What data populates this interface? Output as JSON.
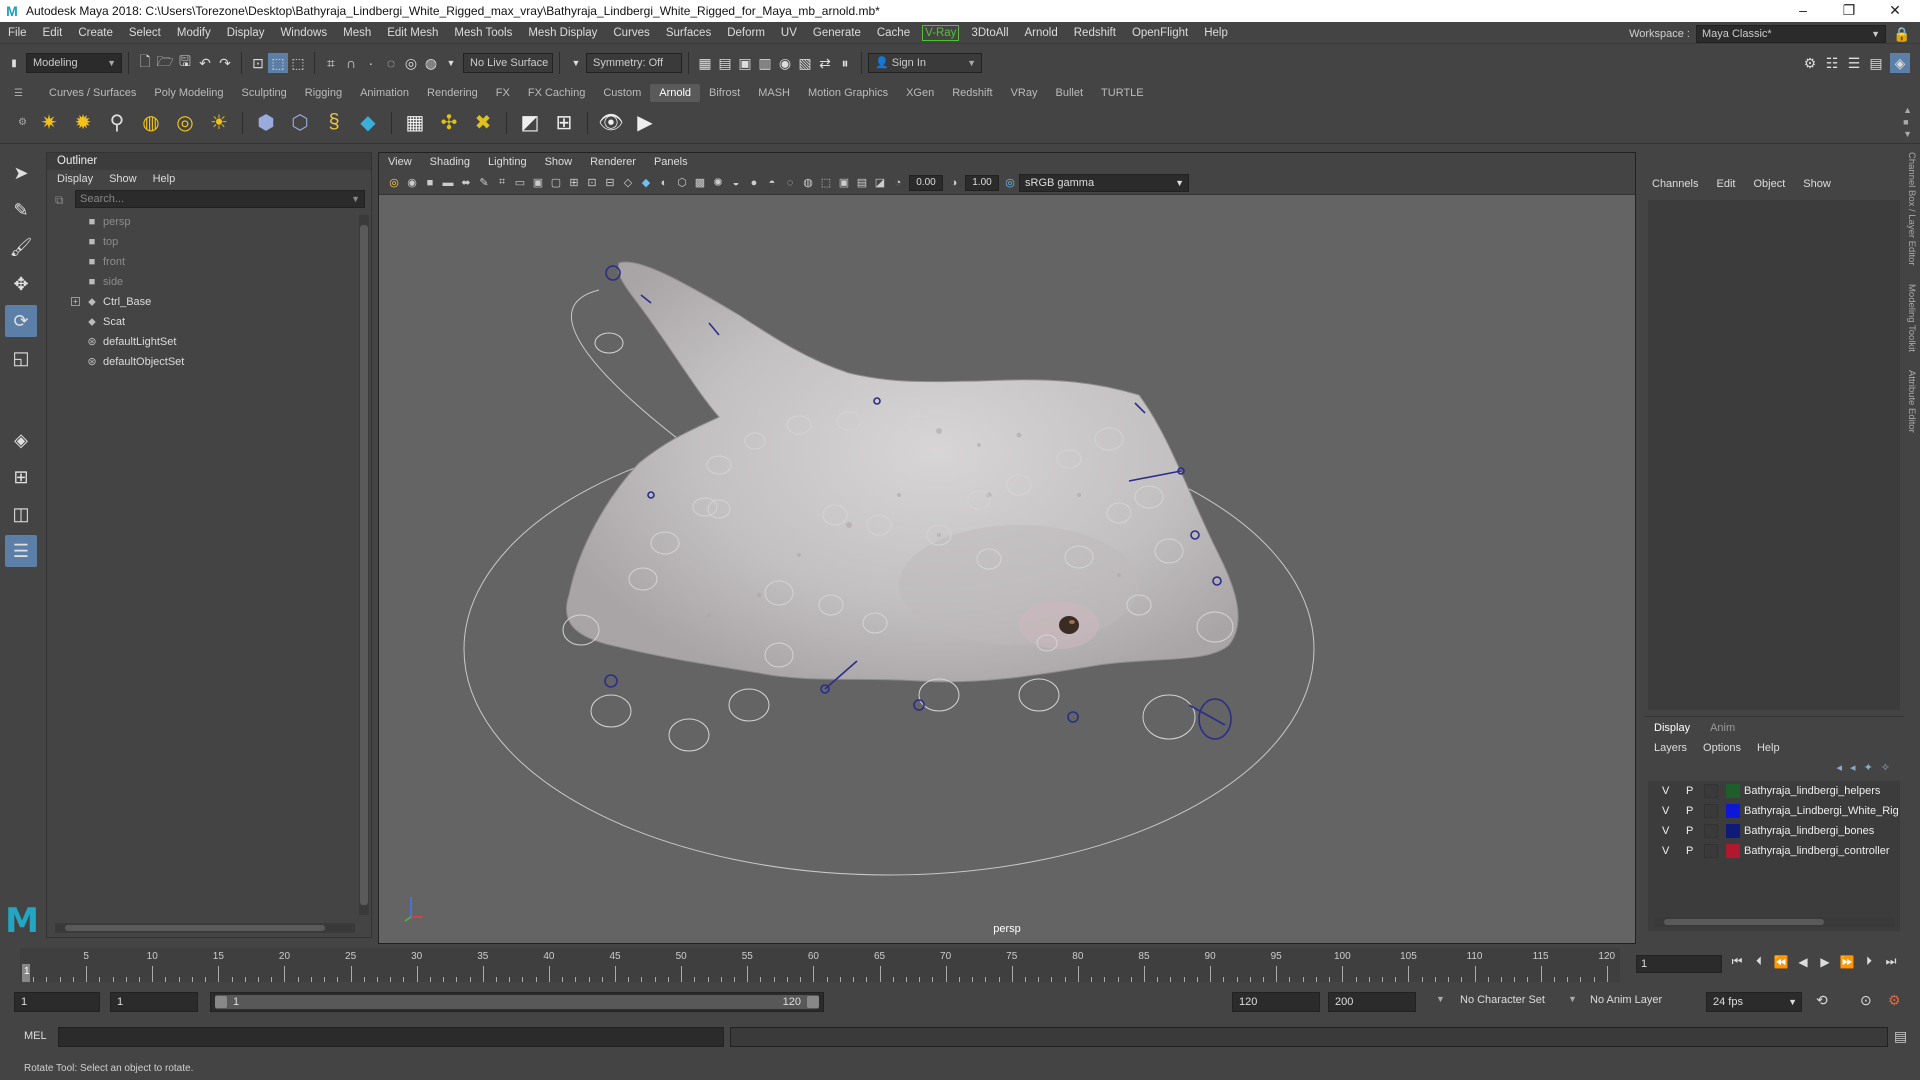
{
  "titlebar": {
    "title": "Autodesk Maya 2018: C:\\Users\\Torezone\\Desktop\\Bathyraja_Lindbergi_White_Rigged_max_vray\\Bathyraja_Lindbergi_White_Rigged_for_Maya_mb_arnold.mb*",
    "logo": "M",
    "minimize": "–",
    "maximize": "❐",
    "close": "✕"
  },
  "menubar": {
    "items": [
      "File",
      "Edit",
      "Create",
      "Select",
      "Modify",
      "Display",
      "Windows",
      "Mesh",
      "Edit Mesh",
      "Mesh Tools",
      "Mesh Display",
      "Curves",
      "Surfaces",
      "Deform",
      "UV",
      "Generate",
      "Cache",
      "V-Ray",
      "3DtoAll",
      "Arnold",
      "Redshift",
      "OpenFlight",
      "Help"
    ],
    "vray_label": "V-Ray",
    "vray_color": "#52c134",
    "workspace_label": "Workspace :",
    "workspace_value": "Maya Classic*"
  },
  "statusline": {
    "mode": "Modeling",
    "live_surface": "No Live Surface",
    "symmetry": "Symmetry: Off",
    "sign_in": "Sign In"
  },
  "shelf": {
    "tabs": [
      "Curves / Surfaces",
      "Poly Modeling",
      "Sculpting",
      "Rigging",
      "Animation",
      "Rendering",
      "FX",
      "FX Caching",
      "Custom",
      "Arnold",
      "Bifrost",
      "MASH",
      "Motion Graphics",
      "XGen",
      "Redshift",
      "VRay",
      "Bullet",
      "TURTLE"
    ],
    "active_tab": "Arnold"
  },
  "outliner": {
    "title": "Outliner",
    "menu": [
      "Display",
      "Show",
      "Help"
    ],
    "search_placeholder": "Search...",
    "items": [
      {
        "label": "persp",
        "icon": "camera-icon",
        "dim": true
      },
      {
        "label": "top",
        "icon": "camera-icon",
        "dim": true
      },
      {
        "label": "front",
        "icon": "camera-icon",
        "dim": true
      },
      {
        "label": "side",
        "icon": "camera-icon",
        "dim": true
      },
      {
        "label": "Ctrl_Base",
        "icon": "transform-icon",
        "dim": false,
        "expandable": true
      },
      {
        "label": "Scat",
        "icon": "transform-icon",
        "dim": false
      },
      {
        "label": "defaultLightSet",
        "icon": "set-icon",
        "dim": false
      },
      {
        "label": "defaultObjectSet",
        "icon": "set-icon",
        "dim": false
      }
    ]
  },
  "viewport": {
    "menu": [
      "View",
      "Shading",
      "Lighting",
      "Show",
      "Renderer",
      "Panels"
    ],
    "exposure": "0.00",
    "gamma": "1.00",
    "colorspace": "sRGB gamma",
    "camera": "persp"
  },
  "channelbox": {
    "menu": [
      "Channels",
      "Edit",
      "Object",
      "Show"
    ],
    "side_tabs": [
      "Channel Box / Layer Editor",
      "Modeling Toolkit",
      "Attribute Editor"
    ]
  },
  "layers": {
    "tabs": [
      "Display",
      "Anim"
    ],
    "active_tab": "Display",
    "menu": [
      "Layers",
      "Options",
      "Help"
    ],
    "rows": [
      {
        "v": "V",
        "p": "P",
        "name": "Bathyraja_lindbergi_helpers",
        "color": "#1e5e2a"
      },
      {
        "v": "V",
        "p": "P",
        "name": "Bathyraja_Lindbergi_White_Rig",
        "color": "#0d17d8"
      },
      {
        "v": "V",
        "p": "P",
        "name": "Bathyraja_lindbergi_bones",
        "color": "#101a78"
      },
      {
        "v": "V",
        "p": "P",
        "name": "Bathyraja_lindbergi_controller",
        "color": "#b01830"
      }
    ]
  },
  "timeline": {
    "ticks": [
      5,
      10,
      15,
      20,
      25,
      30,
      35,
      40,
      45,
      50,
      55,
      60,
      65,
      70,
      75,
      80,
      85,
      90,
      95,
      100,
      105,
      110,
      115,
      120
    ],
    "start_label": "1",
    "current_frame": "1",
    "range_start": "1",
    "range_start2": "1",
    "slider_left": "1",
    "slider_right": "120",
    "range_end": "120",
    "range_end2": "200",
    "character_set": "No Character Set",
    "anim_layer": "No Anim Layer",
    "fps": "24 fps"
  },
  "cmdline": {
    "lang": "MEL",
    "help": "Rotate Tool: Select an object to rotate."
  }
}
